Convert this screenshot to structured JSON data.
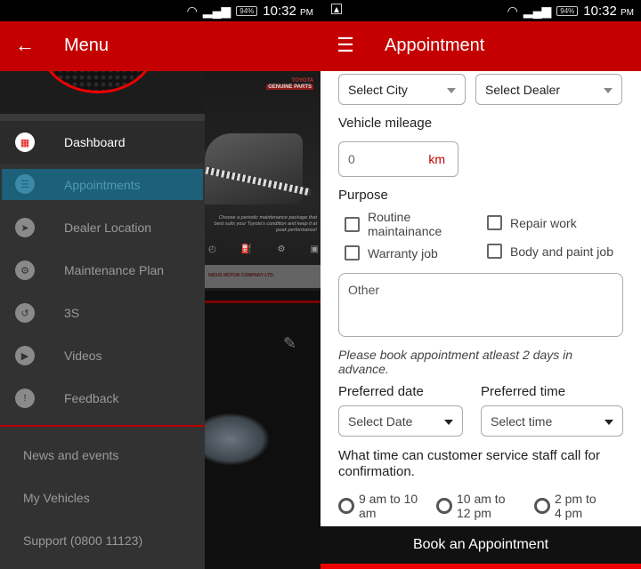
{
  "status_bar": {
    "time": "10:32",
    "ampm": "PM",
    "battery": "94%",
    "wifi_icon": "wifi-icon",
    "signal_icon": "signal-icon",
    "notification_icon": "image-notification-icon"
  },
  "left_screen": {
    "app_bar": {
      "title": "Menu",
      "nav_icon": "back-arrow-icon"
    },
    "menu_items": [
      {
        "label": "Dashboard",
        "icon": "dashboard-icon",
        "state": "default"
      },
      {
        "label": "Appointments",
        "icon": "appointments-icon",
        "state": "selected"
      },
      {
        "label": "Dealer Location",
        "icon": "location-arrow-icon",
        "state": "default"
      },
      {
        "label": "Maintenance Plan",
        "icon": "maintenance-icon",
        "state": "default"
      },
      {
        "label": "3S",
        "icon": "3s-icon",
        "state": "default"
      },
      {
        "label": "Videos",
        "icon": "video-icon",
        "state": "default"
      },
      {
        "label": "Feedback",
        "icon": "feedback-icon",
        "state": "default"
      }
    ],
    "secondary_items": [
      {
        "label": "News and events"
      },
      {
        "label": "My Vehicles"
      },
      {
        "label": "Support (0800 11123)"
      }
    ],
    "background": {
      "poster_brand": "TOYOTA",
      "poster_sub": "GENUINE PARTS",
      "poster_text": "Choose a periodic maintenance package that best suits your Toyota's condition and keep it at peak performance!",
      "poster_icons": [
        "Performance",
        "Oil filter",
        "Maintenance",
        "Service"
      ],
      "poster_footer": "INDUS MOTOR COMPANY LTD.",
      "edit_icon": "pencil-icon"
    }
  },
  "right_screen": {
    "app_bar": {
      "title": "Appointment",
      "nav_icon": "hamburger-menu-icon"
    },
    "city_select": "Select City",
    "dealer_select": "Select Dealer",
    "mileage_label": "Vehicle mileage",
    "mileage_value": "0",
    "mileage_unit": "km",
    "purpose_label": "Purpose",
    "purposes": [
      {
        "label": "Routine maintainance",
        "checked": false
      },
      {
        "label": "Repair work",
        "checked": false
      },
      {
        "label": "Warranty job",
        "checked": false
      },
      {
        "label": "Body and paint job",
        "checked": false
      }
    ],
    "other_placeholder": "Other",
    "note": "Please book appointment atleast 2 days in advance.",
    "date_label": "Preferred date",
    "date_select": "Select Date",
    "time_label": "Preferred time",
    "time_select": "Select time",
    "call_question": "What time can customer service staff call for confirmation.",
    "call_slots": [
      {
        "label": "9 am to 10 am",
        "selected": false
      },
      {
        "label": "10 am to 12 pm",
        "selected": false
      },
      {
        "label": "2 pm to 4 pm",
        "selected": false
      }
    ],
    "book_button": "Book an Appointment"
  },
  "colors": {
    "brand_red": "#c40000",
    "selected_item": "#1c6079",
    "drawer_bg": "#323232"
  }
}
